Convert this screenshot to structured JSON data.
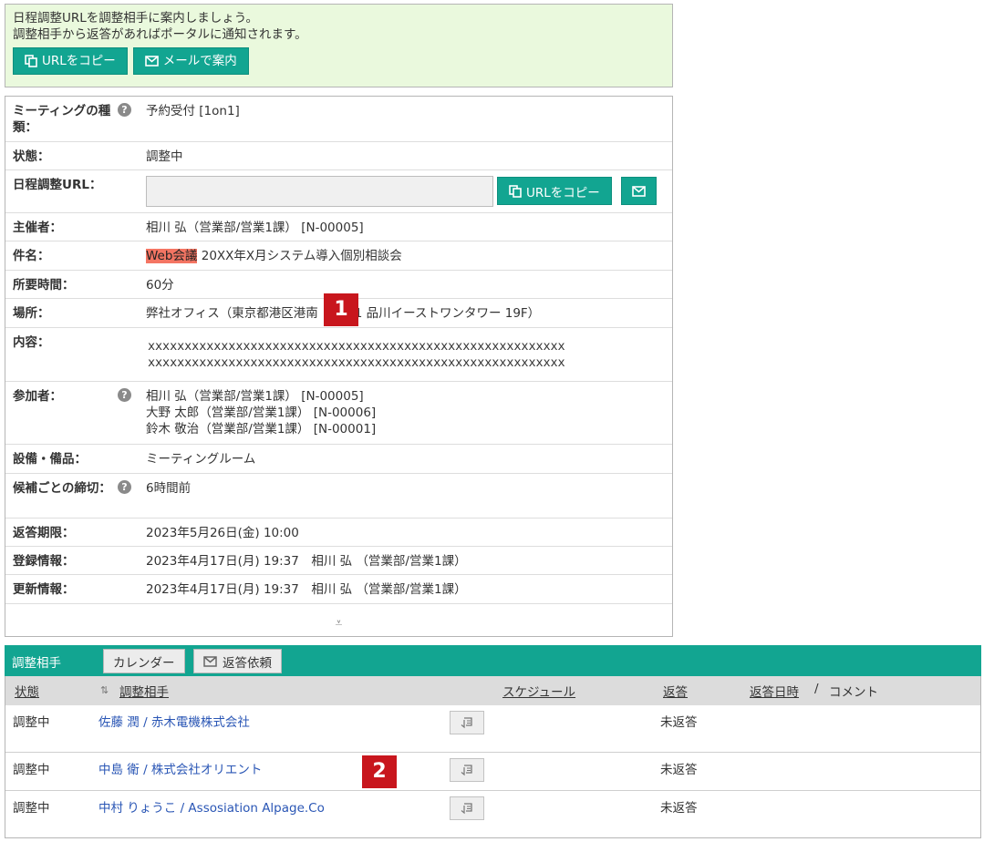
{
  "notice": {
    "line1": "日程調整URLを調整相手に案内しましょう。",
    "line2": "調整相手から返答があればポータルに通知されます。",
    "copy_url": "URLをコピー",
    "mail_guide": "メールで案内"
  },
  "info": {
    "meeting_type_label": "ミーティングの種類：",
    "meeting_type_value": "予約受付 [1on1]",
    "status_label": "状態：",
    "status_value": "調整中",
    "url_label": "日程調整URL：",
    "url_value": "",
    "url_copy": "URLをコピー",
    "organizer_label": "主催者：",
    "organizer_value": "相川 弘（営業部/営業1課） [N-00005]",
    "subject_label": "件名：",
    "subject_tag": "Web会議",
    "subject_value": " 20XX年X月システム導入個別相談会",
    "duration_label": "所要時間：",
    "duration_value": "60分",
    "place_label": "場所：",
    "place_value_a": "弊社オフィス（東京都港区港南",
    "place_value_b": "1 品川イーストワンタワー 19F）",
    "content_label": "内容：",
    "content_line1": "xxxxxxxxxxxxxxxxxxxxxxxxxxxxxxxxxxxxxxxxxxxxxxxxxxxxxxxxx",
    "content_line2": "xxxxxxxxxxxxxxxxxxxxxxxxxxxxxxxxxxxxxxxxxxxxxxxxxxxxxxxxx",
    "participants_label": "参加者：",
    "participants": [
      "相川 弘（営業部/営業1課） [N-00005]",
      "大野 太郎（営業部/営業1課） [N-00006]",
      "鈴木 敬治（営業部/営業1課） [N-00001]"
    ],
    "equipment_label": "設備・備品：",
    "equipment_value": "ミーティングルーム",
    "deadline_each_label": "候補ごとの締切：",
    "deadline_each_value": "6時間前",
    "reply_deadline_label": "返答期限：",
    "reply_deadline_value": "2023年5月26日(金) 10:00",
    "registered_label": "登録情報：",
    "registered_value": "2023年4月17日(月) 19:37　相川 弘 （営業部/営業1課）",
    "updated_label": "更新情報：",
    "updated_value": "2023年4月17日(月) 19:37　相川 弘 （営業部/営業1課）",
    "expand_glyph": "⩡"
  },
  "markers": {
    "m1": "1",
    "m2": "2"
  },
  "partners": {
    "title": "調整相手",
    "calendar_btn": "カレンダー",
    "request_btn": "返答依頼",
    "headers": {
      "status": "状態",
      "partner": "調整相手",
      "schedule": "スケジュール",
      "reply": "返答",
      "reply_date": "返答日時",
      "sep": "/",
      "comment": "コメント"
    },
    "rows": [
      {
        "status": "調整中",
        "partner": "佐藤 潤 / 赤木電機株式会社",
        "reply": "未返答"
      },
      {
        "status": "調整中",
        "partner": "中島 衛 / 株式会社オリエント",
        "reply": "未返答"
      },
      {
        "status": "調整中",
        "partner": "中村 りょうこ / Assosiation Alpage.Co",
        "reply": "未返答"
      }
    ]
  },
  "colors": {
    "accent": "#12a591",
    "notice_bg": "#eaf9dd",
    "marker": "#c8161d",
    "tag_highlight": "#f47563",
    "link": "#2a56b5"
  }
}
